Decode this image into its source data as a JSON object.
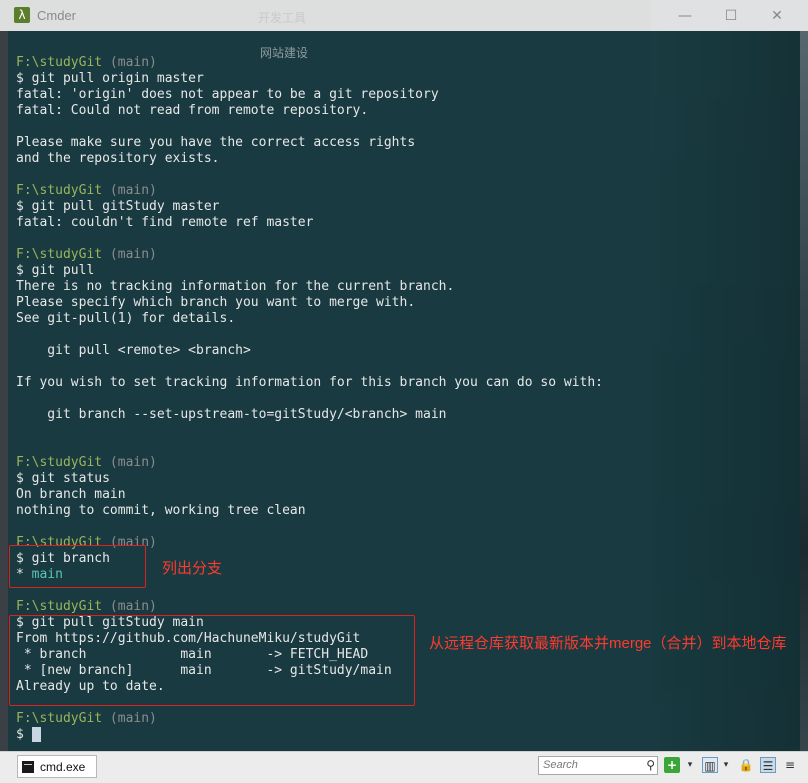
{
  "window": {
    "title": "Cmder",
    "app_icon": "λ",
    "controls": {
      "minimize": "—",
      "maximize": "☐",
      "close": "✕"
    }
  },
  "background": {
    "ghost_title": "开发工具",
    "ghost_label": "网站建设"
  },
  "terminal": {
    "lines": [
      {
        "type": "prompt",
        "path": "F:\\studyGit",
        "branch": "(main)"
      },
      {
        "type": "text",
        "text": "$ git pull origin master"
      },
      {
        "type": "text",
        "text": "fatal: 'origin' does not appear to be a git repository"
      },
      {
        "type": "text",
        "text": "fatal: Could not read from remote repository."
      },
      {
        "type": "text",
        "text": ""
      },
      {
        "type": "text",
        "text": "Please make sure you have the correct access rights"
      },
      {
        "type": "text",
        "text": "and the repository exists."
      },
      {
        "type": "text",
        "text": ""
      },
      {
        "type": "prompt",
        "path": "F:\\studyGit",
        "branch": "(main)"
      },
      {
        "type": "text",
        "text": "$ git pull gitStudy master"
      },
      {
        "type": "text",
        "text": "fatal: couldn't find remote ref master"
      },
      {
        "type": "text",
        "text": ""
      },
      {
        "type": "prompt",
        "path": "F:\\studyGit",
        "branch": "(main)"
      },
      {
        "type": "text",
        "text": "$ git pull"
      },
      {
        "type": "text",
        "text": "There is no tracking information for the current branch."
      },
      {
        "type": "text",
        "text": "Please specify which branch you want to merge with."
      },
      {
        "type": "text",
        "text": "See git-pull(1) for details."
      },
      {
        "type": "text",
        "text": ""
      },
      {
        "type": "text",
        "text": "    git pull <remote> <branch>"
      },
      {
        "type": "text",
        "text": ""
      },
      {
        "type": "text",
        "text": "If you wish to set tracking information for this branch you can do so with:"
      },
      {
        "type": "text",
        "text": ""
      },
      {
        "type": "text",
        "text": "    git branch --set-upstream-to=gitStudy/<branch> main"
      },
      {
        "type": "text",
        "text": ""
      },
      {
        "type": "text",
        "text": ""
      },
      {
        "type": "prompt",
        "path": "F:\\studyGit",
        "branch": "(main)"
      },
      {
        "type": "text",
        "text": "$ git status"
      },
      {
        "type": "text",
        "text": "On branch main"
      },
      {
        "type": "text",
        "text": "nothing to commit, working tree clean"
      },
      {
        "type": "text",
        "text": ""
      },
      {
        "type": "prompt",
        "path": "F:\\studyGit",
        "branch": "(main)"
      },
      {
        "type": "text",
        "text": "$ git branch"
      },
      {
        "type": "current_branch",
        "star": "* ",
        "name": "main"
      },
      {
        "type": "text",
        "text": ""
      },
      {
        "type": "prompt",
        "path": "F:\\studyGit",
        "branch": "(main)"
      },
      {
        "type": "text",
        "text": "$ git pull gitStudy main"
      },
      {
        "type": "text",
        "text": "From https://github.com/HachuneMiku/studyGit"
      },
      {
        "type": "text",
        "text": " * branch            main       -> FETCH_HEAD"
      },
      {
        "type": "text",
        "text": " * [new branch]      main       -> gitStudy/main"
      },
      {
        "type": "text",
        "text": "Already up to date."
      },
      {
        "type": "text",
        "text": ""
      },
      {
        "type": "prompt",
        "path": "F:\\studyGit",
        "branch": "(main)"
      },
      {
        "type": "cursor",
        "text": "$ "
      }
    ]
  },
  "annotations": {
    "note1": "列出分支",
    "note2": "从远程仓库获取最新版本并merge（合并）到本地仓库",
    "color": "#e0201c"
  },
  "statusbar": {
    "tab_label": "cmd.exe",
    "search_placeholder": "Search",
    "buttons": {
      "add": "+",
      "dropdown": "▾",
      "split": "▥",
      "lock": "🔒",
      "list": "☰",
      "menu": "≡"
    }
  },
  "colors": {
    "terminal_bg": "#173a40",
    "prompt_path": "#9ab45a",
    "prompt_branch": "#8c8c8c",
    "branch_highlight": "#5bc4b5"
  }
}
